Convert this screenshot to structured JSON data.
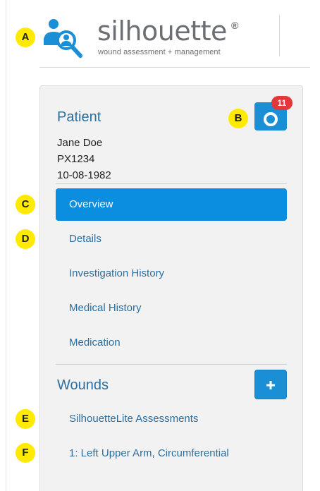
{
  "brand": {
    "name": "silhouette",
    "registered_mark": "®",
    "tagline": "wound assessment + management",
    "logo_icon": "person-magnifier-icon"
  },
  "patient": {
    "section_title": "Patient",
    "name": "Jane Doe",
    "id": "PX1234",
    "dob": "10-08-1982",
    "camera_icon": "camera-icon",
    "camera_badge_count": "11"
  },
  "nav": {
    "items": [
      {
        "label": "Overview",
        "active": true
      },
      {
        "label": "Details",
        "active": false
      },
      {
        "label": "Investigation History",
        "active": false
      },
      {
        "label": "Medical History",
        "active": false
      },
      {
        "label": "Medication",
        "active": false
      }
    ]
  },
  "wounds": {
    "section_title": "Wounds",
    "add_icon": "plus-icon",
    "items": [
      {
        "label": "SilhouetteLite Assessments"
      },
      {
        "label": "1: Left Upper Arm, Circumferential"
      }
    ]
  },
  "markers": [
    "A",
    "B",
    "C",
    "D",
    "E",
    "F"
  ],
  "colors": {
    "accent": "#0b8ee0",
    "link": "#2a6fa0",
    "badge": "#e4373a",
    "marker": "#ffea00"
  }
}
